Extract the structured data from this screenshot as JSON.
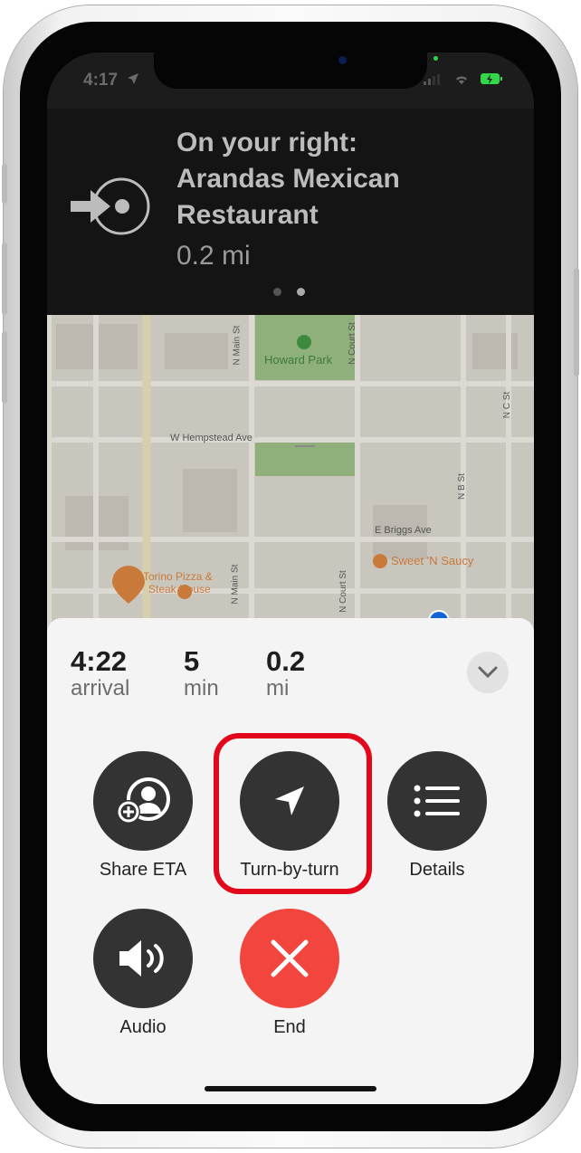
{
  "status_bar": {
    "time": "4:17",
    "icons": [
      "location-arrow-icon",
      "signal-icon",
      "wifi-icon",
      "battery-charging-icon"
    ],
    "battery_color": "#32d74b"
  },
  "banner": {
    "line1": "On your right:",
    "line2": "Arandas Mexican",
    "line3": "Restaurant",
    "distance": "0.2 mi",
    "icon": "arrive-right-icon",
    "page_count": 2,
    "current_page": 2
  },
  "map": {
    "labels": {
      "park": "Howard Park",
      "w_hempstead": "W Hempstead Ave",
      "n_main_top": "N Main St",
      "n_court_top": "N Court St",
      "n_c": "N C St",
      "n_b": "N B St",
      "e_briggs": "E Briggs Ave",
      "sweet": "Sweet 'N Saucy",
      "torino1": "Torino Pizza &",
      "torino2": "Steak House",
      "n_main_bottom": "N Main St",
      "n_court_bottom": "N Court St"
    },
    "park_color": "#8fb07a",
    "poi_color": "#c97a3a"
  },
  "trip": {
    "arrival_value": "4:22",
    "arrival_label": "arrival",
    "time_value": "5",
    "time_label": "min",
    "distance_value": "0.2",
    "distance_label": "mi"
  },
  "actions": [
    {
      "label": "Share ETA",
      "icon": "share-eta-icon"
    },
    {
      "label": "Turn-by-turn",
      "icon": "navigation-arrow-icon",
      "highlighted": true
    },
    {
      "label": "Details",
      "icon": "list-icon"
    },
    {
      "label": "Audio",
      "icon": "speaker-icon"
    },
    {
      "label": "End",
      "icon": "close-icon",
      "color": "#f2453d"
    }
  ],
  "highlight_color": "#e3071b"
}
